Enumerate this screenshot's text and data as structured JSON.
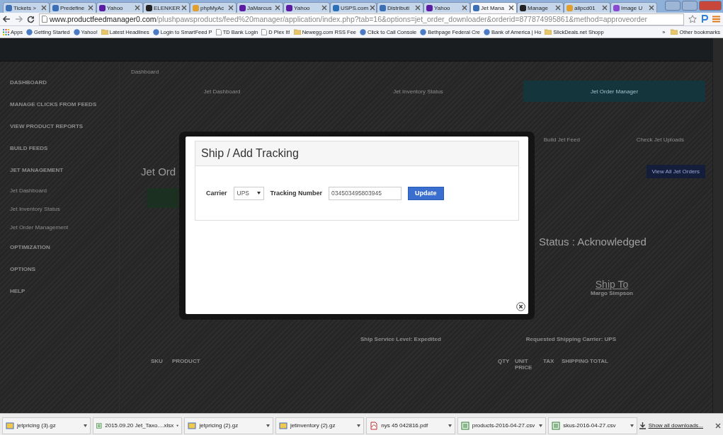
{
  "browser": {
    "tabs": [
      {
        "title": "Tickets >",
        "color": "#3b6fb6",
        "selected": false
      },
      {
        "title": "Predefine",
        "color": "#3b6fb6",
        "selected": false
      },
      {
        "title": "Yahoo",
        "color": "#5c1ba3",
        "selected": false
      },
      {
        "title": "ELENKER",
        "color": "#222222",
        "selected": false
      },
      {
        "title": "phpMyAc",
        "color": "#e0a030",
        "selected": false
      },
      {
        "title": "JaMarcus",
        "color": "#5c1ba3",
        "selected": false
      },
      {
        "title": "Yahoo",
        "color": "#5c1ba3",
        "selected": false
      },
      {
        "title": "USPS.com",
        "color": "#2a6fb8",
        "selected": false
      },
      {
        "title": "Distributi",
        "color": "#3b6fb6",
        "selected": false
      },
      {
        "title": "Yahoo",
        "color": "#5c1ba3",
        "selected": false
      },
      {
        "title": "Jet Mana",
        "color": "#3b6fb6",
        "selected": true
      },
      {
        "title": "Manage",
        "color": "#222222",
        "selected": false
      },
      {
        "title": "allpcd01",
        "color": "#e0a030",
        "selected": false
      },
      {
        "title": "Image U",
        "color": "#8a4ad0",
        "selected": false
      }
    ],
    "url_domain": "www.productfeedmanager0.com",
    "url_path": "/plushpawsproducts/feed%20manager/application/index.php?tab=16&options=jet_order_downloader&orderid=877874995861&method=approveorder",
    "bookmarks": [
      {
        "label": "Apps",
        "kind": "apps"
      },
      {
        "label": "Getting Started",
        "kind": "site"
      },
      {
        "label": "Yahoo!",
        "kind": "site"
      },
      {
        "label": "Latest Headlines",
        "kind": "folder"
      },
      {
        "label": "Login to SmartFeed P",
        "kind": "site"
      },
      {
        "label": "TD Bank Login",
        "kind": "page"
      },
      {
        "label": "D Plex It!",
        "kind": "page"
      },
      {
        "label": "Newegg.com RSS Fee",
        "kind": "folder"
      },
      {
        "label": "Click to Call Console",
        "kind": "site"
      },
      {
        "label": "Bethpage Federal Cre",
        "kind": "site"
      },
      {
        "label": "Bank of America | Ho",
        "kind": "site"
      },
      {
        "label": "SlickDeals.net Shopp",
        "kind": "folder"
      }
    ],
    "bookmarks_more": "»",
    "other_bookmarks": "Other bookmarks"
  },
  "sidebar": {
    "items": [
      {
        "label": "DASHBOARD",
        "kind": "section"
      },
      {
        "label": "MANAGE CLICKS FROM FEEDS",
        "kind": "section"
      },
      {
        "label": "VIEW PRODUCT REPORTS",
        "kind": "section"
      },
      {
        "label": "BUILD FEEDS",
        "kind": "section"
      },
      {
        "label": "JET MANAGEMENT",
        "kind": "section"
      },
      {
        "label": "Jet Dashboard",
        "kind": "sub"
      },
      {
        "label": "Jet Inventory Status",
        "kind": "sub"
      },
      {
        "label": "Jet Order Management",
        "kind": "sub"
      },
      {
        "label": "OPTIMIZATION",
        "kind": "section"
      },
      {
        "label": "OPTIONS",
        "kind": "section"
      },
      {
        "label": "HELP",
        "kind": "section"
      }
    ]
  },
  "main": {
    "breadcrumb": "Dashboard",
    "tiles": [
      {
        "label": "Jet Dashboard",
        "selected": false
      },
      {
        "label": "Jet Inventory Status",
        "selected": false
      },
      {
        "label": "Jet Order Manager",
        "selected": true
      }
    ],
    "icon_labels": [
      "Build Jet Feed",
      "Check Jet Uploads"
    ],
    "heading": "Jet Ord",
    "view_all_button": "View All Jet Orders",
    "status": "Status : Acknowledged",
    "ship_to_title": "Ship To",
    "ship_to_name": "Margo Simpson",
    "service_level_label": "Ship Service Level:",
    "service_level": "Expedited",
    "carrier_label": "Requested Shipping Carrier:",
    "carrier": "UPS",
    "columns": [
      "SKU",
      "PRODUCT",
      "QTY",
      "UNIT PRICE",
      "TAX",
      "SHIPPING",
      "TOTAL"
    ]
  },
  "modal": {
    "title": "Ship / Add Tracking",
    "carrier_label": "Carrier",
    "carrier_value": "UPS",
    "tracking_label": "Tracking Number",
    "tracking_value": "034503495803945",
    "update_button": "Update"
  },
  "downloads": {
    "items": [
      {
        "name": "jetpricing (3).gz",
        "kind": "archive"
      },
      {
        "name": "2015.09.20 Jet_Taxo....xlsx",
        "kind": "sheet"
      },
      {
        "name": "jetpricing (2).gz",
        "kind": "archive"
      },
      {
        "name": "jetinventory (2).gz",
        "kind": "archive"
      },
      {
        "name": "nys 45 042816.pdf",
        "kind": "pdf"
      },
      {
        "name": "products-2016-04-27.csv",
        "kind": "sheet"
      },
      {
        "name": "skus-2016-04-27.csv",
        "kind": "sheet"
      }
    ],
    "show_all": "Show all downloads..."
  }
}
